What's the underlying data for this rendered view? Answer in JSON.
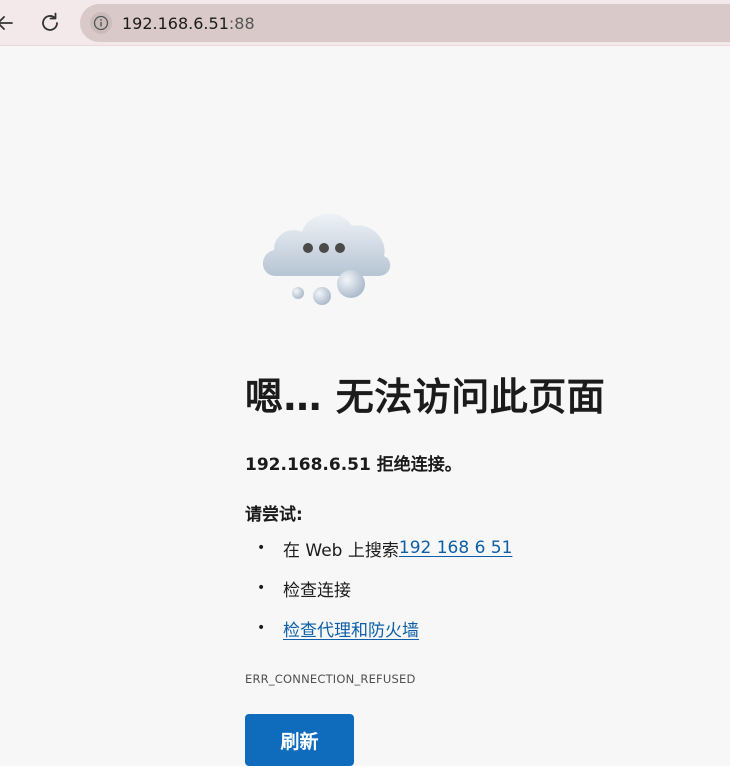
{
  "toolbar": {
    "url_host": "192.168.6.51",
    "url_port": ":88"
  },
  "error_page": {
    "heading": "嗯… 无法访问此页面",
    "refused_host": "192.168.6.51",
    "refused_text": " 拒绝连接。",
    "try_label": "请尝试:",
    "suggestions": [
      {
        "prefix": "在 Web 上搜索 ",
        "link": "192 168 6 51"
      },
      {
        "prefix": "检查连接",
        "link": ""
      },
      {
        "prefix": "",
        "link": "检查代理和防火墙"
      }
    ],
    "error_code": "ERR_CONNECTION_REFUSED",
    "refresh_label": "刷新"
  },
  "colors": {
    "accent": "#0f6cbd",
    "link": "#0c5fa8",
    "toolbar_bg": "#f3e9ea",
    "address_bg": "#d9c9c9"
  }
}
